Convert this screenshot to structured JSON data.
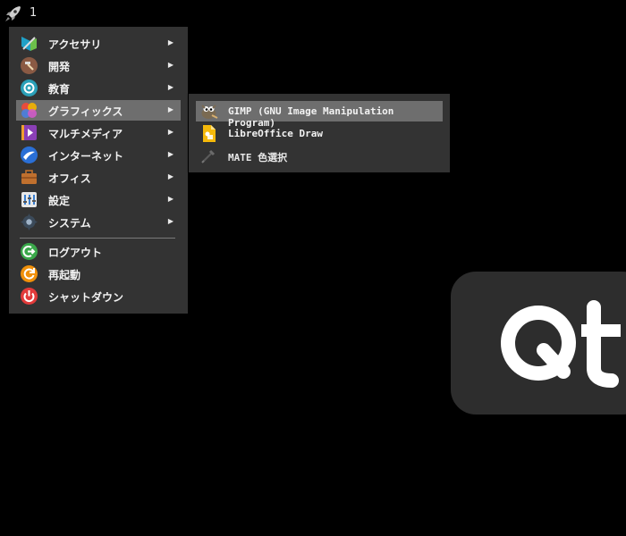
{
  "topbar": {
    "workspace_number": "1",
    "launcher_icon": "rocket-icon"
  },
  "menu": {
    "items": [
      {
        "label": "アクセサリ",
        "icon": "accessories-icon",
        "submenu": true
      },
      {
        "label": "開発",
        "icon": "hammer-icon",
        "submenu": true
      },
      {
        "label": "教育",
        "icon": "education-icon",
        "submenu": true
      },
      {
        "label": "グラフィックス",
        "icon": "graphics-icon",
        "submenu": true,
        "active": true
      },
      {
        "label": "マルチメディア",
        "icon": "multimedia-icon",
        "submenu": true
      },
      {
        "label": "インターネット",
        "icon": "internet-icon",
        "submenu": true
      },
      {
        "label": "オフィス",
        "icon": "office-briefcase-icon",
        "submenu": true
      },
      {
        "label": "設定",
        "icon": "settings-icon",
        "submenu": true
      },
      {
        "label": "システム",
        "icon": "system-gear-icon",
        "submenu": true
      }
    ],
    "actions": [
      {
        "label": "ログアウト",
        "icon": "logout-icon"
      },
      {
        "label": "再起動",
        "icon": "restart-icon"
      },
      {
        "label": "シャットダウン",
        "icon": "shutdown-icon"
      }
    ],
    "arrow": "▶"
  },
  "submenu": {
    "items": [
      {
        "label": "GIMP (GNU Image Manipulation Program)",
        "icon": "gimp-icon",
        "active": true
      },
      {
        "label": "LibreOffice Draw",
        "icon": "libreoffice-draw-icon"
      },
      {
        "label": "MATE 色選択",
        "icon": "color-picker-icon"
      }
    ]
  },
  "colors": {
    "menu_bg": "#333333",
    "highlight": "#6e6e6e",
    "desktop": "#000000"
  }
}
